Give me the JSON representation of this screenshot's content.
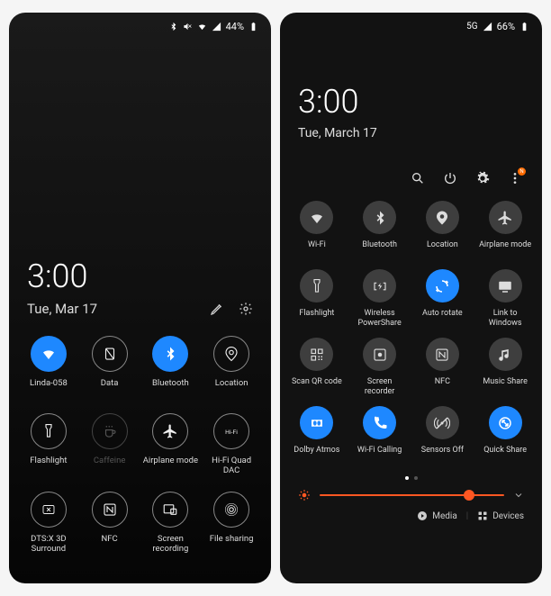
{
  "left": {
    "status": {
      "battery_pct": "44%"
    },
    "time": "3:00",
    "date": "Tue, Mar 17",
    "tiles": [
      {
        "id": "wifi",
        "label": "Linda-058",
        "style": "fill-blue",
        "icon": "wifi"
      },
      {
        "id": "data",
        "label": "Data",
        "style": "outline",
        "icon": "data"
      },
      {
        "id": "bluetooth",
        "label": "Bluetooth",
        "style": "fill-blue",
        "icon": "bluetooth"
      },
      {
        "id": "location",
        "label": "Location",
        "style": "outline",
        "icon": "location"
      },
      {
        "id": "flashlight",
        "label": "Flashlight",
        "style": "outline",
        "icon": "flashlight"
      },
      {
        "id": "caffeine",
        "label": "Caffeine",
        "style": "outline dim",
        "labelStyle": "dim",
        "icon": "coffee"
      },
      {
        "id": "airplane",
        "label": "Airplane mode",
        "style": "outline",
        "icon": "airplane"
      },
      {
        "id": "hifidac",
        "label": "Hi-Fi Quad DAC",
        "style": "outline",
        "icon": "hifi"
      },
      {
        "id": "dtsx",
        "label": "DTS:X 3D Surround",
        "style": "outline",
        "icon": "dtsx"
      },
      {
        "id": "nfc",
        "label": "NFC",
        "style": "outline",
        "icon": "nfc"
      },
      {
        "id": "screenrec-l",
        "label": "Screen recording",
        "style": "outline",
        "icon": "screenrec"
      },
      {
        "id": "fileshare",
        "label": "File sharing",
        "style": "outline",
        "icon": "fileshare"
      }
    ]
  },
  "right": {
    "status": {
      "net": "5G",
      "signal": "sig",
      "battery_pct": "66%"
    },
    "time": "3:00",
    "date": "Tue, March 17",
    "tiles": [
      {
        "id": "wifi-r",
        "label": "Wi-Fi",
        "style": "fill-grey",
        "icon": "wifi"
      },
      {
        "id": "bluetooth-r",
        "label": "Bluetooth",
        "style": "fill-grey",
        "icon": "bluetooth"
      },
      {
        "id": "location-r",
        "label": "Location",
        "style": "fill-grey",
        "icon": "location-fill"
      },
      {
        "id": "airplane-r",
        "label": "Airplane mode",
        "style": "fill-grey",
        "icon": "airplane"
      },
      {
        "id": "flashlight-r",
        "label": "Flashlight",
        "style": "fill-grey",
        "icon": "flashlight"
      },
      {
        "id": "powershare",
        "label": "Wireless PowerShare",
        "style": "fill-grey",
        "icon": "powershare"
      },
      {
        "id": "autorotate",
        "label": "Auto rotate",
        "style": "fill-blue",
        "icon": "rotate"
      },
      {
        "id": "linkwin",
        "label": "Link to Windows",
        "style": "fill-grey",
        "icon": "linkwin"
      },
      {
        "id": "scanqr",
        "label": "Scan QR code",
        "style": "fill-grey",
        "icon": "qr"
      },
      {
        "id": "screenrec",
        "label": "Screen recorder",
        "style": "fill-grey",
        "icon": "screenrec2"
      },
      {
        "id": "nfc-r",
        "label": "NFC",
        "style": "fill-grey",
        "icon": "nfc"
      },
      {
        "id": "musicshare",
        "label": "Music Share",
        "style": "fill-grey",
        "icon": "music"
      },
      {
        "id": "dolby",
        "label": "Dolby Atmos",
        "style": "fill-blue",
        "icon": "dolby"
      },
      {
        "id": "wificall",
        "label": "Wi-Fi Calling",
        "style": "fill-blue",
        "icon": "wificall"
      },
      {
        "id": "sensorsoff",
        "label": "Sensors Off",
        "style": "fill-grey",
        "icon": "sensors"
      },
      {
        "id": "quickshare",
        "label": "Quick Share",
        "style": "fill-blue",
        "icon": "quickshare"
      }
    ],
    "footer": {
      "media": "Media",
      "devices": "Devices"
    }
  }
}
